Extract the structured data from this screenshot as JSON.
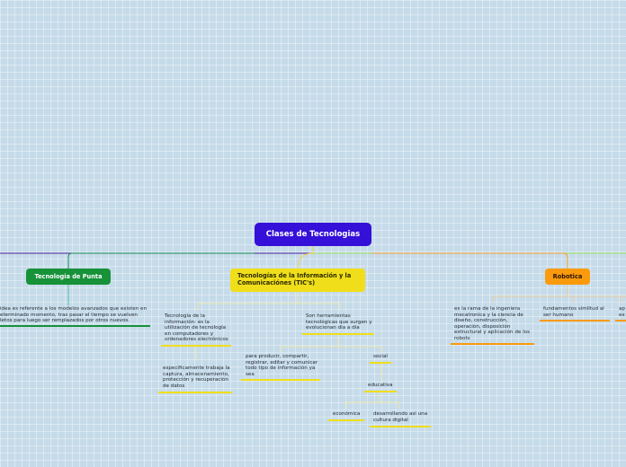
{
  "root": {
    "label": "Clases de Tecnologias"
  },
  "branches": {
    "punta": {
      "label": "Tecnologia de Punta",
      "child": "idea es referente a los modelos avanzados que existen en\neterminado momento, tras pasar el tiempo se vuelven\nletos para luego ser remplazados por otros nuevos."
    },
    "tics": {
      "label": "Tecnologías de la Información y la\nComunicaciónes (TIC's)",
      "def": "Tecnología de la\ninformación: es la\nutilización de tecnología\nen computadores y\nordenadores electrónicos",
      "def_detail": "especificamente trabaja la\ncaptura, almacenamiento,\nprotección y recuperación\nde datos",
      "tools": "Son herramientas\ntecnológicas que surgen y\nevolucionan dia a dia",
      "tools_detail": "para producir, compartir,\nregistrar, editar y comunicar\ntodo tipo de información ya\nsea",
      "social": "social",
      "educativa": "educativa",
      "economica": "económica",
      "cultura": "desarrollando asi una\ncultura digital"
    },
    "robotica": {
      "label": "Robotica",
      "child1": "es la rama de la ingeniera\nmecatronica y la ciencia de\ndiseño, construcción,\noperación, disposición\nestructural y aplicación de los\nrobots",
      "child2": "fundamentos simlitud al\nser humano",
      "child3": "ap\nex"
    }
  },
  "colors": {
    "root": "#3410d8",
    "punta": "#179239",
    "tics": "#f0de1a",
    "robotica": "#fb9a0c",
    "background": "#c6dbe9"
  }
}
